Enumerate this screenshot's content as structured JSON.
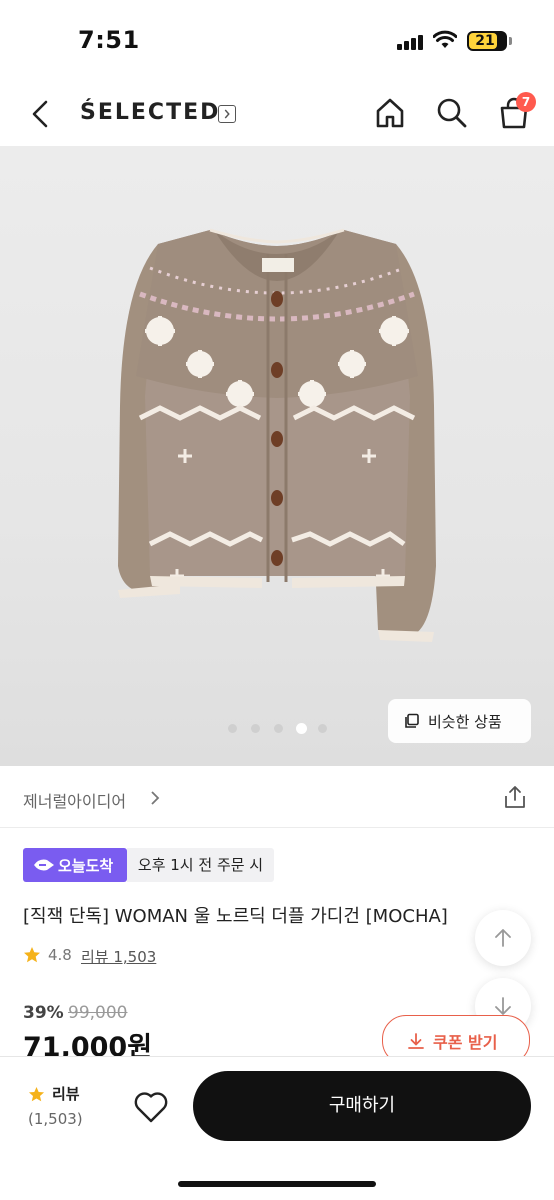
{
  "status_bar": {
    "time": "7:51",
    "battery": "21"
  },
  "nav": {
    "brand": "ŚELECTED",
    "cart_count": "7"
  },
  "product_image": {
    "similar_label": "비슷한 상품",
    "slide_count": 5,
    "active_slide": 4
  },
  "seller": {
    "name": "제너럴아이디어"
  },
  "delivery": {
    "badge": "오늘도착",
    "deadline": "오후 1시 전 주문 시"
  },
  "product": {
    "title": "[직잭 단독] WOMAN 울 노르딕 더플 가디건 [MOCHA]",
    "rating": "4.8",
    "review_text": "리뷰 1,503",
    "discount": "39%",
    "original_price": "99,000",
    "sale_price": "71,000원"
  },
  "coupon": {
    "label": "쿠폰 받기"
  },
  "bottom_bar": {
    "review_label": "리뷰",
    "review_count": "(1,503)",
    "buy_label": "구매하기"
  },
  "colors": {
    "accent_purple": "#7a5cf0",
    "coupon_red": "#e8604a",
    "badge_red": "#ff5a4e"
  }
}
